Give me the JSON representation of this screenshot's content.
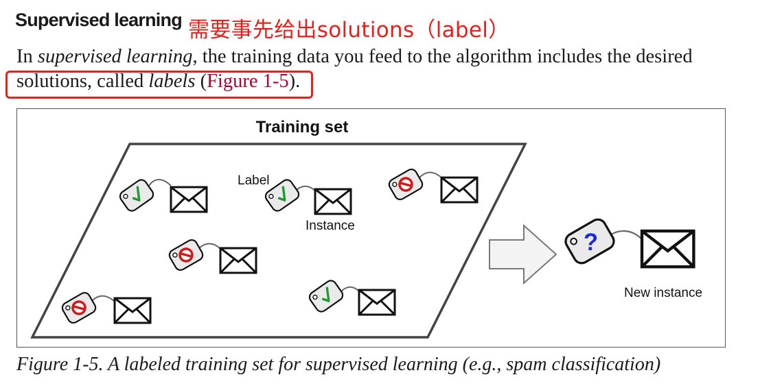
{
  "section": {
    "heading": "Supervised learning",
    "annotation": "需要事先给出solutions（label）"
  },
  "paragraph": {
    "line1_prefix": "In ",
    "line1_term": "supervised learning",
    "line1_suffix": ", the training data you feed to the algorithm includes the desired",
    "line2_prefix": "solutions, called ",
    "line2_term": "labels",
    "line2_paren_open": " (",
    "link_text": "Figure 1-5",
    "line2_paren_close": ")."
  },
  "figure": {
    "title": "Training set",
    "label_callout": "Label",
    "instance_callout": "Instance",
    "new_instance_label": "New instance",
    "unknown_label_symbol": "?",
    "caption": "Figure 1-5. A labeled training set for supervised learning (e.g., spam classification)",
    "items": [
      "ham",
      "ham",
      "spam",
      "spam",
      "spam",
      "ham"
    ],
    "icons": {
      "ham": "green-check-tag",
      "spam": "red-no-entry-tag",
      "unknown": "question-mark-tag",
      "instance": "envelope"
    }
  },
  "colors": {
    "annotation": "#e8201c",
    "link": "#b3002d",
    "check": "#1e9a2e",
    "spam": "#d11a1a",
    "question": "#1f2bd6"
  }
}
